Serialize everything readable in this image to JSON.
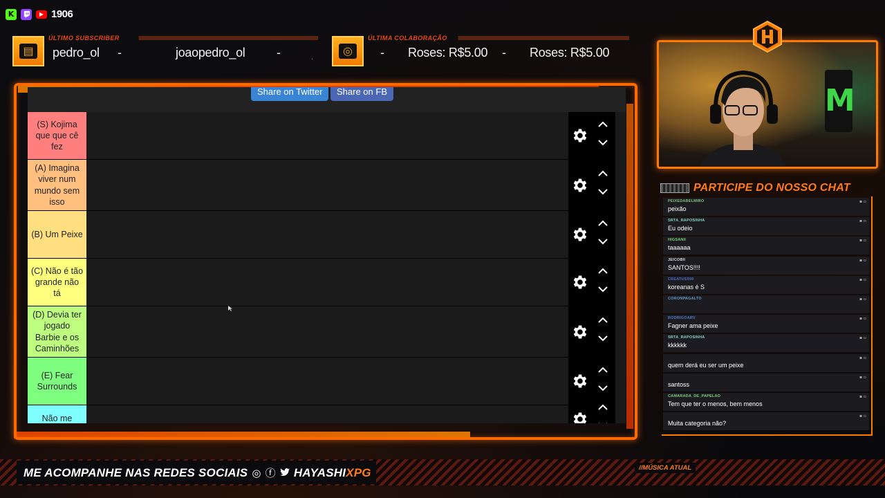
{
  "social": {
    "count": "1906",
    "icons": [
      "kick-icon",
      "twitch-icon",
      "youtube-icon"
    ]
  },
  "tickers": {
    "subscriber": {
      "label": "ÚLTIMO SUBSCRIBER",
      "items": [
        "pedro_ol",
        "-",
        "joaopedro_ol",
        "-",
        "jo"
      ]
    },
    "collab": {
      "label": "ÚLTIMA COLABORAÇÃO",
      "items": [
        "-",
        "Roses: R$5.00",
        "-",
        "Roses: R$5.00"
      ]
    }
  },
  "tierlist": {
    "share_twitter": "Share on Twitter",
    "share_fb": "Share on FB",
    "tiers": [
      {
        "label": "(S) Kojima que que cê fez",
        "color": "#ff7f7f"
      },
      {
        "label": "(A) Imagina viver num mundo sem isso",
        "color": "#ffbf7f"
      },
      {
        "label": "(B) Um Peixe",
        "color": "#ffdf7f"
      },
      {
        "label": "(C) Não é tão grande não tá",
        "color": "#ffff7f"
      },
      {
        "label": "(D) Devia ter jogado Barbie e os Caminhões",
        "color": "#bfff7f"
      },
      {
        "label": "(E) Fear Surrounds",
        "color": "#7fff7f"
      },
      {
        "label": "Não me",
        "color": "#7fffff"
      }
    ]
  },
  "chat": {
    "title": "PARTICIPE DO NOSSO CHAT",
    "messages": [
      {
        "user": "PEIXEDABELMIRO",
        "text": "peixão",
        "color": "#7fbf7f"
      },
      {
        "user": "SRTA_RAPOSINHA",
        "text": "Eu odeio",
        "color": "#7fd0c0"
      },
      {
        "user": "HIGSANII",
        "text": "taaaaaa",
        "color": "#7ad07a"
      },
      {
        "user": "JEICOBII",
        "text": "SANTOS!!!!",
        "color": "#dddddd"
      },
      {
        "user": "CREATUS999",
        "text": "koreanas é S",
        "color": "#4a6ad0"
      },
      {
        "user": "CORONPAGALTO",
        "text": "",
        "color": "#5a9ad0"
      },
      {
        "user": "RODRIGOARV",
        "text": "Fagner ama peixe",
        "color": "#4a7ad0"
      },
      {
        "user": "SRTA_RAPOSINHA",
        "text": "kkkkkk",
        "color": "#7fd0c0"
      },
      {
        "user": "",
        "text": "quem derá eu ser um peixe",
        "color": "#2a3ab0"
      },
      {
        "user": "",
        "text": "santoss",
        "color": "#3a4ac0"
      },
      {
        "user": "CAMARADA_DE_PAPELAO",
        "text": "Tem que ter o menos, bem menos",
        "color": "#7ad07a"
      },
      {
        "user": "",
        "text": "Muita categoria não?",
        "color": "#c02020"
      }
    ]
  },
  "bottom": {
    "follow_text": "ME ACOMPANHE NAS REDES SOCIAIS",
    "handle_a": "HAYASHI",
    "handle_b": "XPG",
    "music_label": "//MÚSICA ATUAL"
  }
}
